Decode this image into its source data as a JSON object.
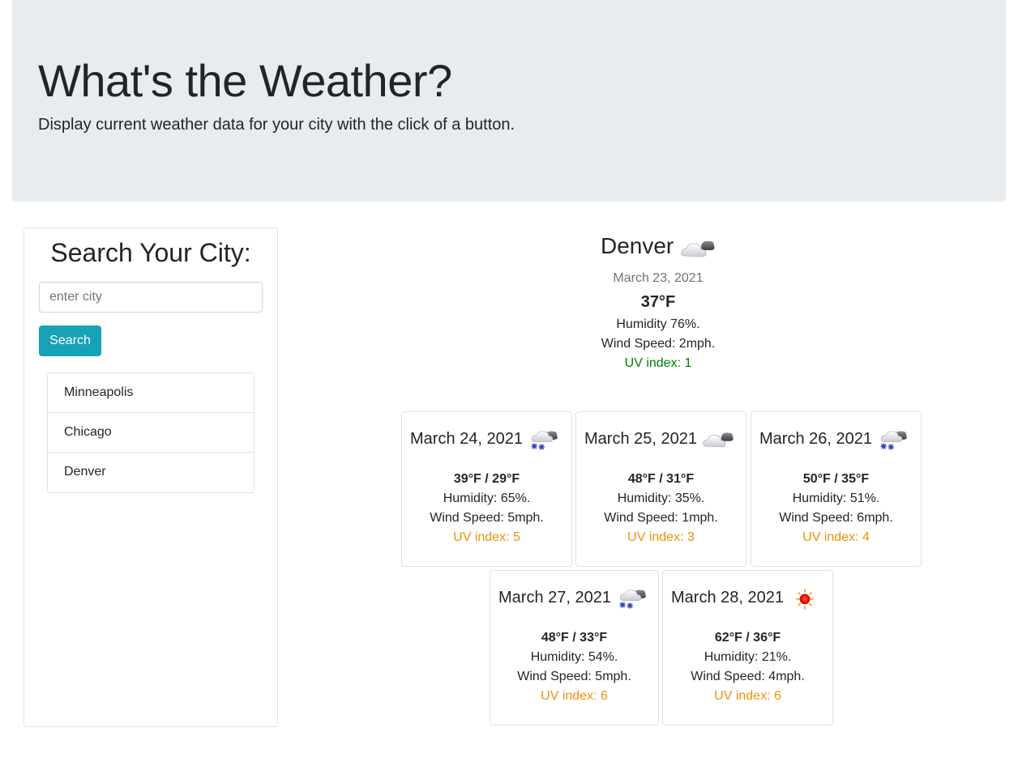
{
  "header": {
    "title": "What's the Weather?",
    "lead": "Display current weather data for your city with the click of a button."
  },
  "search": {
    "title": "Search Your City:",
    "placeholder": "enter city",
    "button_label": "Search",
    "history": [
      "Minneapolis",
      "Chicago",
      "Denver"
    ]
  },
  "current": {
    "city": "Denver",
    "icon": "broken-clouds-icon",
    "date": "March 23, 2021",
    "temp": "37°F",
    "humidity": "Humidity 76%.",
    "wind": "Wind Speed: 2mph.",
    "uv": "UV index: 1",
    "uv_color": "#008000"
  },
  "forecast": [
    {
      "date": "March 24, 2021",
      "icon": "snow-icon",
      "temps": "39°F / 29°F",
      "humidity": "Humidity: 65%.",
      "wind": "Wind Speed: 5mph.",
      "uv": "UV index: 5"
    },
    {
      "date": "March 25, 2021",
      "icon": "broken-clouds-icon",
      "temps": "48°F / 31°F",
      "humidity": "Humidity: 35%.",
      "wind": "Wind Speed: 1mph.",
      "uv": "UV index: 3"
    },
    {
      "date": "March 26, 2021",
      "icon": "snow-icon",
      "temps": "50°F / 35°F",
      "humidity": "Humidity: 51%.",
      "wind": "Wind Speed: 6mph.",
      "uv": "UV index: 4"
    },
    {
      "date": "March 27, 2021",
      "icon": "snow-icon",
      "temps": "48°F / 33°F",
      "humidity": "Humidity: 54%.",
      "wind": "Wind Speed: 5mph.",
      "uv": "UV index: 6"
    },
    {
      "date": "March 28, 2021",
      "icon": "clear-sky-icon",
      "temps": "62°F / 36°F",
      "humidity": "Humidity: 21%.",
      "wind": "Wind Speed: 4mph.",
      "uv": "UV index: 6"
    }
  ],
  "colors": {
    "jumbotron_bg": "#e9ecef",
    "button": "#17a2b8",
    "uv_low": "#008000",
    "uv_moderate": "#f0900a"
  }
}
